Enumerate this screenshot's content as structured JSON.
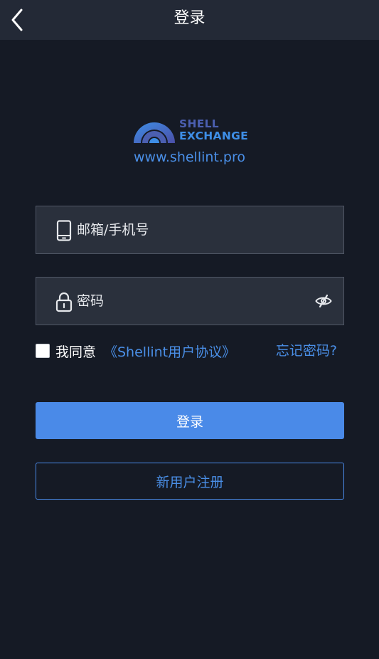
{
  "header": {
    "title": "登录",
    "back_icon": "chevron-left-icon"
  },
  "brand": {
    "name_line1": "SHELL",
    "name_line2": "EXCHANGE",
    "url": "www.shellint.pro",
    "colors": {
      "primary": "#4b5fb0",
      "accent": "#3e8ee6"
    }
  },
  "form": {
    "account_field": {
      "placeholder": "邮箱/手机号",
      "value": "",
      "icon": "phone-icon"
    },
    "password_field": {
      "placeholder": "密码",
      "value": "",
      "icon": "lock-icon",
      "toggle_icon": "eye-hidden-icon"
    },
    "agree": {
      "checked": false,
      "label": "我同意",
      "link_text": "《Shellint用户协议》"
    },
    "forgot_password": "忘记密码?",
    "login_label": "登录",
    "register_label": "新用户注册"
  },
  "theme": {
    "background": "#151a25",
    "topbar": "#232936",
    "field_bg": "#2a303c",
    "accent": "#4a8ae8"
  }
}
